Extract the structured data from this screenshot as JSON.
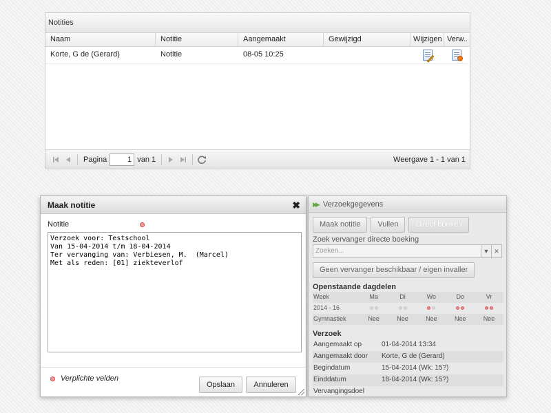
{
  "notities": {
    "caption": "Notities",
    "columns": [
      "Naam",
      "Notitie",
      "Aangemaakt",
      "Gewijzigd",
      "Wijzigen",
      "Verw..."
    ],
    "rows": [
      {
        "naam": "Korte, G de (Gerard)",
        "notitie": "Notitie",
        "aangemaakt": "08-05 10:25",
        "gewijzigd": ""
      }
    ],
    "pager": {
      "page_label": "Pagina",
      "page_value": "1",
      "of_label": "van 1",
      "info": "Weergave 1 - 1 van 1"
    },
    "icons": [
      "first-page-icon",
      "prev-page-icon",
      "next-page-icon",
      "last-page-icon",
      "refresh-icon",
      "edit-note-icon",
      "delete-note-icon"
    ]
  },
  "dialog": {
    "title": "Maak notitie",
    "close_glyph": "✖",
    "field_label": "Notitie",
    "text": "Verzoek voor: Testschool\nVan 15-04-2014 t/m 18-04-2014\nTer vervanging van: Verbiesen, M.  (Marcel)\nMet als reden: [01] ziekteverlof",
    "required_note": "Verplichte velden",
    "save_label": "Opslaan",
    "cancel_label": "Annuleren"
  },
  "verzoek_panel": {
    "title": "Verzoekgegevens",
    "buttons": {
      "maak_notitie": "Maak notitie",
      "vullen": "Vullen",
      "direct_boeken": "Direct boeken"
    },
    "zoek_label": "Zoek vervanger directe boeking",
    "search_placeholder": "Zoeken...",
    "geen_vervanger": "Geen vervanger beschikbaar / eigen invaller",
    "openstaande_title": "Openstaande dagdelen",
    "week_header": {
      "label": "Week",
      "days": [
        "Ma",
        "Di",
        "Wo",
        "Do",
        "Vr"
      ]
    },
    "week_row": {
      "label": "2014 - 16",
      "marked": [
        false,
        false,
        true,
        true,
        true
      ]
    },
    "vak_row": {
      "label": "Gymnastiek",
      "values": [
        "Nee",
        "Nee",
        "Nee",
        "Nee",
        "Nee"
      ]
    },
    "verzoek_title": "Verzoek",
    "info": [
      {
        "key": "Aangemaakt op",
        "value": "01-04-2014 13:34"
      },
      {
        "key": "Aangemaakt door",
        "value": "Korte, G de (Gerard)"
      },
      {
        "key": "Begindatum",
        "value": "15-04-2014 (Wk: 15?)"
      },
      {
        "key": "Einddatum",
        "value": "18-04-2014 (Wk: 15?)"
      },
      {
        "key": "Vervangingsdoel",
        "value": ""
      }
    ]
  },
  "colors": {
    "required_dot": "#f39a9a",
    "accent_arrow": "#6aa54a"
  }
}
